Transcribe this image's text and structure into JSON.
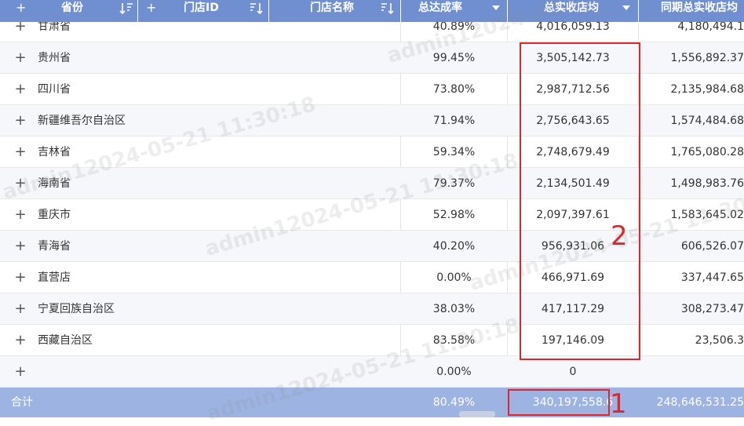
{
  "header": {
    "columns": [
      {
        "label": "省份",
        "plus": "+"
      },
      {
        "label": "门店ID",
        "plus": "+"
      },
      {
        "label": "门店名称"
      },
      {
        "label": "总达成率"
      },
      {
        "label": "总实收店均"
      },
      {
        "label": "同期总实收店均"
      }
    ]
  },
  "rows": [
    {
      "expand": "+",
      "province": "甘肃省",
      "rate": "40.89%",
      "actual": "4,016,059.13",
      "prev": "4,180,494.1"
    },
    {
      "expand": "+",
      "province": "贵州省",
      "rate": "99.45%",
      "actual": "3,505,142.73",
      "prev": "1,556,892.37"
    },
    {
      "expand": "+",
      "province": "四川省",
      "rate": "73.80%",
      "actual": "2,987,712.56",
      "prev": "2,135,984.68"
    },
    {
      "expand": "+",
      "province": "新疆维吾尔自治区",
      "rate": "71.94%",
      "actual": "2,756,643.65",
      "prev": "1,574,484.68"
    },
    {
      "expand": "+",
      "province": "吉林省",
      "rate": "59.34%",
      "actual": "2,748,679.49",
      "prev": "1,765,080.28"
    },
    {
      "expand": "+",
      "province": "海南省",
      "rate": "79.37%",
      "actual": "2,134,501.49",
      "prev": "1,498,983.76"
    },
    {
      "expand": "+",
      "province": "重庆市",
      "rate": "52.98%",
      "actual": "2,097,397.61",
      "prev": "1,583,645.02"
    },
    {
      "expand": "+",
      "province": "青海省",
      "rate": "40.20%",
      "actual": "956,931.06",
      "prev": "606,526.07"
    },
    {
      "expand": "+",
      "province": "直营店",
      "rate": "0.00%",
      "actual": "466,971.69",
      "prev": "337,447.65"
    },
    {
      "expand": "+",
      "province": "宁夏回族自治区",
      "rate": "38.03%",
      "actual": "417,117.29",
      "prev": "308,273.47"
    },
    {
      "expand": "+",
      "province": "西藏自治区",
      "rate": "83.58%",
      "actual": "197,146.09",
      "prev": "23,506.3"
    },
    {
      "expand": "+",
      "province": "",
      "rate": "0.00%",
      "actual": "0",
      "prev": ""
    }
  ],
  "total": {
    "label": "合计",
    "rate": "80.49%",
    "actual": "340,197,558.6",
    "prev": "248,646,531.25"
  },
  "annotations": {
    "box1": "1",
    "box2": "2"
  },
  "watermark": "admin12024-05-21 11:30:18",
  "colors": {
    "header_bg": "#6f8fd0",
    "total_bg": "#9db3e1",
    "annotation_red": "#e0262b",
    "alt_row": "#f5f7fb"
  }
}
